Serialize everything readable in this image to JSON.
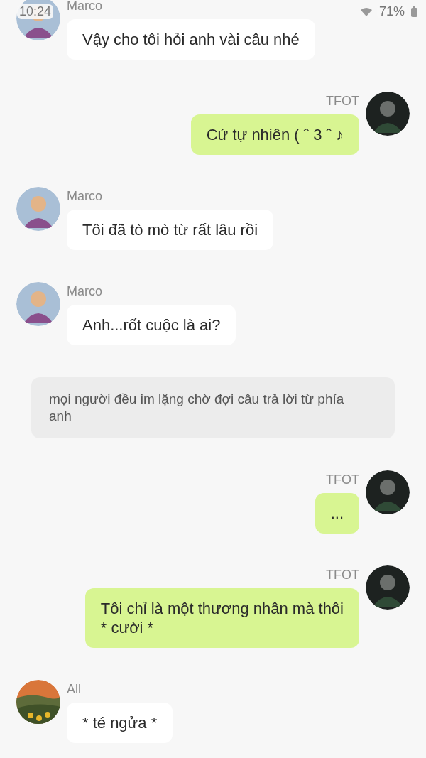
{
  "status_bar": {
    "time": "10:24",
    "battery": "71%"
  },
  "messages": [
    {
      "kind": "incoming",
      "sender": "Marco",
      "avatar": {
        "kind": "figure"
      },
      "text": "Vậy cho tôi hỏi anh vài câu nhé"
    },
    {
      "kind": "outgoing",
      "sender": "TFOT",
      "avatar": {
        "kind": "figure"
      },
      "text": "Cứ tự nhiên ( ˆ 3 ˆ ♪"
    },
    {
      "kind": "incoming",
      "sender": "Marco",
      "avatar": {
        "kind": "figure"
      },
      "text": "Tôi đã tò mò từ rất lâu rồi"
    },
    {
      "kind": "incoming",
      "sender": "Marco",
      "avatar": {
        "kind": "figure"
      },
      "text": "Anh...rốt cuộc là ai?"
    },
    {
      "kind": "narration",
      "text": "mọi người đều im lặng chờ đợi câu trả lời từ phía anh"
    },
    {
      "kind": "outgoing",
      "sender": "TFOT",
      "avatar": {
        "kind": "figure"
      },
      "text": "..."
    },
    {
      "kind": "outgoing",
      "sender": "TFOT",
      "avatar": {
        "kind": "figure"
      },
      "text": "Tôi chỉ là một thương nhân mà thôi\n* cười *"
    },
    {
      "kind": "incoming",
      "sender": "All",
      "text": "* té ngửa *"
    }
  ]
}
